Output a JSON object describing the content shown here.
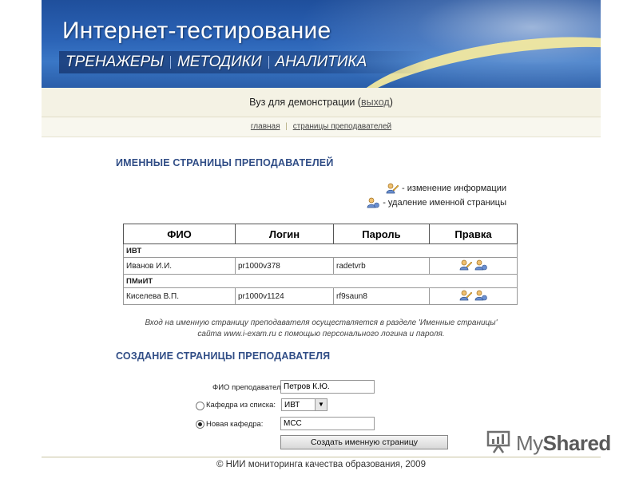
{
  "banner": {
    "title": "Интернет-тестирование",
    "nav": [
      "ТРЕНАЖЕРЫ",
      "МЕТОДИКИ",
      "АНАЛИТИКА"
    ]
  },
  "userbar": {
    "prefix": "Вуз для демонстрации (",
    "logout": "выход",
    "suffix": ")"
  },
  "breadcrumbs": {
    "home": "главная",
    "separator": "|",
    "current": "страницы преподавателей"
  },
  "teachers_section": {
    "title": "ИМЕННЫЕ СТРАНИЦЫ ПРЕПОДАВАТЕЛЕЙ",
    "legend_edit": "- изменение информации",
    "legend_delete": "- удаление именной страницы",
    "table": {
      "headers": [
        "ФИО",
        "Логин",
        "Пароль",
        "Правка"
      ],
      "groups": [
        {
          "name": "ИВТ",
          "rows": [
            {
              "fio": "Иванов И.И.",
              "login": "pr1000v378",
              "password": "radetvrb"
            }
          ]
        },
        {
          "name": "ПМиИТ",
          "rows": [
            {
              "fio": "Киселева В.П.",
              "login": "pr1000v1124",
              "password": "rf9saun8"
            }
          ]
        }
      ]
    },
    "note_line1": "Вход на именную страницу преподавателя осуществляется в разделе 'Именные страницы'",
    "note_line2": "сайта www.i-exam.ru с помощью персонального логина и пароля."
  },
  "create_section": {
    "title": "СОЗДАНИЕ СТРАНИЦЫ ПРЕПОДАВАТЕЛЯ",
    "fio_label": "ФИО преподавателя:",
    "fio_value": "Петров К.Ю.",
    "dept_list_label": "Кафедра из списка:",
    "dept_selected": "ИВТ",
    "new_dept_label": "Новая кафедра:",
    "new_dept_value": "МСС",
    "submit_label": "Создать именную страницу"
  },
  "footer": {
    "text": "© НИИ мониторинга качества образования, 2009"
  },
  "watermark": {
    "text_a": "My",
    "text_b": "Shared"
  },
  "colors": {
    "banner_blue": "#2b63b6",
    "section_title": "#304d86",
    "swoosh_yellow": "#f2e8a0"
  }
}
